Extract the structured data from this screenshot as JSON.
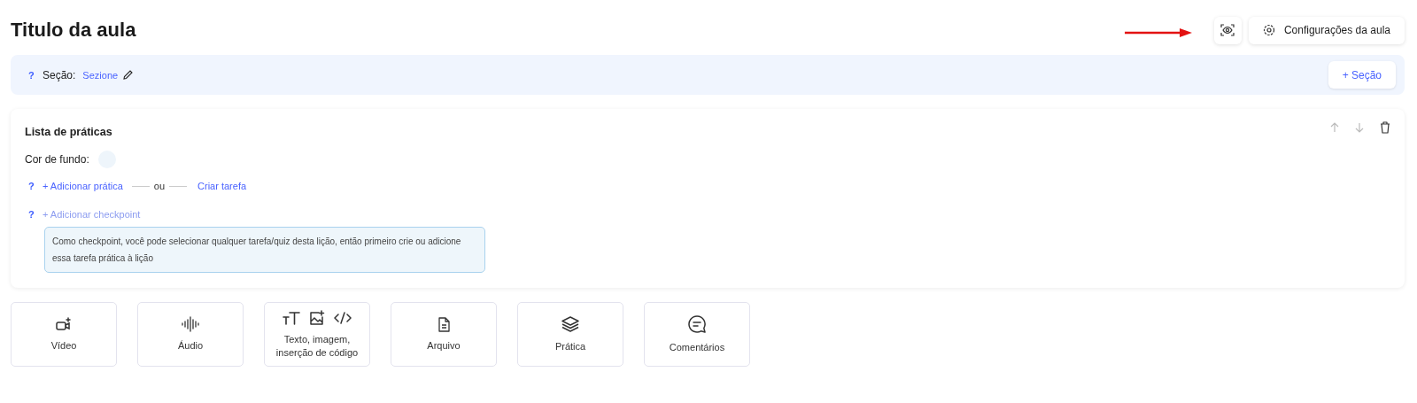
{
  "title": "Titulo da aula",
  "header_buttons": {
    "settings": "Configurações da aula"
  },
  "section_bar": {
    "help": "?",
    "label": "Seção:",
    "value": "Sezione",
    "add_button": "+ Seção"
  },
  "card": {
    "title": "Lista de práticas",
    "background_label": "Cor de fundo:",
    "help_1": "?",
    "add_practice": "+ Adicionar prática",
    "or": "ou",
    "create_task": "Criar tarefa",
    "help_2": "?",
    "add_checkpoint": {
      "label": "+ Adicionar checkpoint",
      "disabled": true
    },
    "info": "Como checkpoint, você pode selecionar qualquer tarefa/quiz desta lição, então primeiro crie ou adicione essa tarefa prática à lição"
  },
  "tiles": [
    {
      "kind": "video",
      "label": "Vídeo"
    },
    {
      "kind": "audio",
      "label": "Áudio"
    },
    {
      "kind": "text",
      "label": "Texto, imagem, inserção de código"
    },
    {
      "kind": "file",
      "label": "Arquivo"
    },
    {
      "kind": "practice",
      "label": "Prática"
    },
    {
      "kind": "comments",
      "label": "Comentários"
    }
  ]
}
